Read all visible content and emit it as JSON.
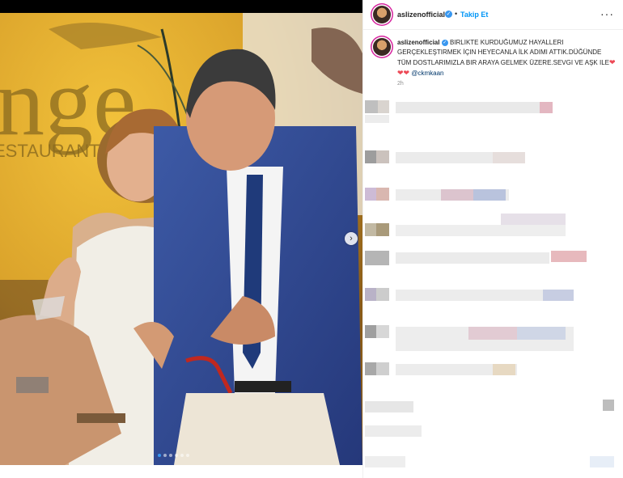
{
  "post": {
    "username": "aslizenofficial",
    "follow_label": "Takip Et",
    "separator": "•",
    "more_label": "···",
    "verified_glyph": "✓",
    "caption_text": "BIRLIKTE KURDUĞUMUZ HAYALLERI GERÇEKLEŞTIRMEK İÇIN HEYECANLA İLK ADIMI ATTIK.DÜĞÜNDE TÜM DOSTLARIMIZLA BIR ARAYA GELMEK ÜZERE.SEVGI VE AŞK ILE",
    "hearts": "❤❤❤",
    "mention": "@ckmkaan",
    "time": "2h"
  },
  "photo": {
    "sign_text": "nge",
    "sign_subtext": "ESTAURANT",
    "next_glyph": "›",
    "slide_count": 6,
    "active_slide": 0
  },
  "colors": {
    "accent": "#0095f6",
    "verified": "#3897f0",
    "heart": "#ed4956",
    "wall": "#e8b62a"
  },
  "icons": [
    "verified-icon",
    "more-options-icon",
    "carousel-next-icon",
    "heart-icon"
  ]
}
